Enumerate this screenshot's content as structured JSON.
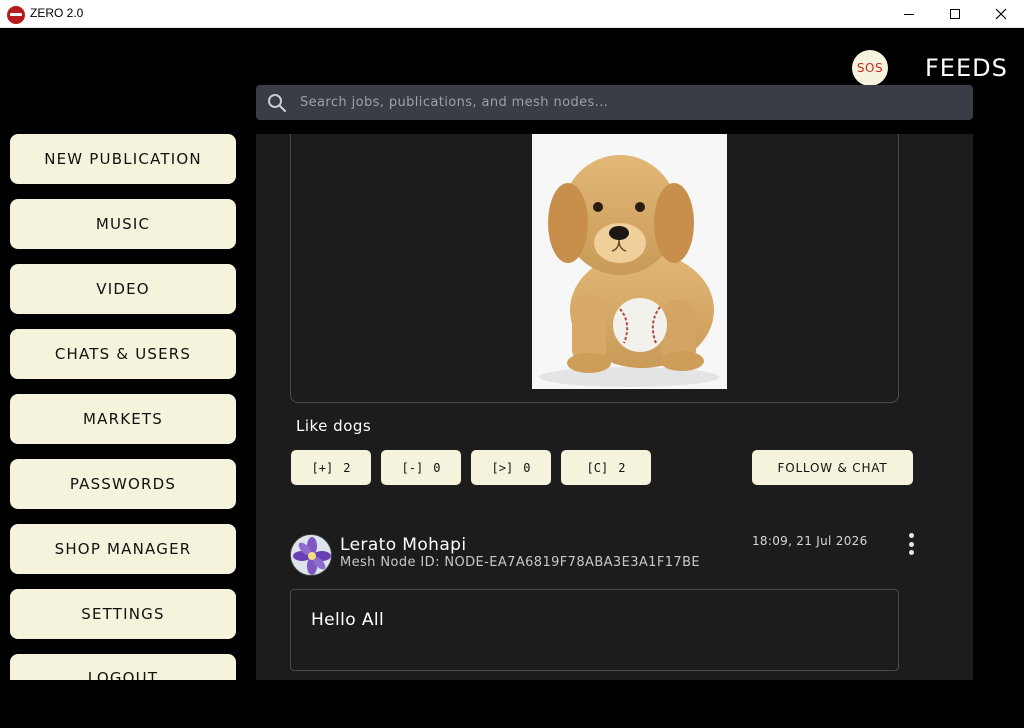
{
  "window": {
    "title": "ZERO 2.0",
    "logo_color": "#b71c1c"
  },
  "header": {
    "sos_label": "SOS",
    "section_title": "FEEDS"
  },
  "search": {
    "placeholder": "Search jobs, publications, and mesh nodes...",
    "value": ""
  },
  "sidebar": {
    "items": [
      {
        "label": "NEW PUBLICATION"
      },
      {
        "label": "MUSIC"
      },
      {
        "label": "VIDEO"
      },
      {
        "label": "CHATS & USERS"
      },
      {
        "label": "MARKETS"
      },
      {
        "label": "PASSWORDS"
      },
      {
        "label": "SHOP MANAGER"
      },
      {
        "label": "SETTINGS"
      },
      {
        "label": "LOGOUT"
      }
    ]
  },
  "feed": {
    "post1": {
      "image": "golden-retriever-puppy-with-baseball",
      "caption": "Like dogs",
      "actions": [
        {
          "symbol": "[+]",
          "count": "2"
        },
        {
          "symbol": "[-]",
          "count": "0"
        },
        {
          "symbol": "[>]",
          "count": "0"
        },
        {
          "symbol": "[C]",
          "count": "2"
        }
      ],
      "follow_label": "FOLLOW & CHAT"
    },
    "post2": {
      "author": "Lerato Mohapi",
      "node_id": "Mesh Node ID: NODE-EA7A6819F78ABA3E3A1F17BE",
      "timestamp": "18:09, 21 Jul 2026",
      "text": "Hello All",
      "avatar": "purple-flower"
    }
  },
  "colors": {
    "background": "#000000",
    "panel": "#1c1c1c",
    "button": "#f6f3dc",
    "search_bg": "#3a3d43",
    "sos_text": "#c62828"
  }
}
